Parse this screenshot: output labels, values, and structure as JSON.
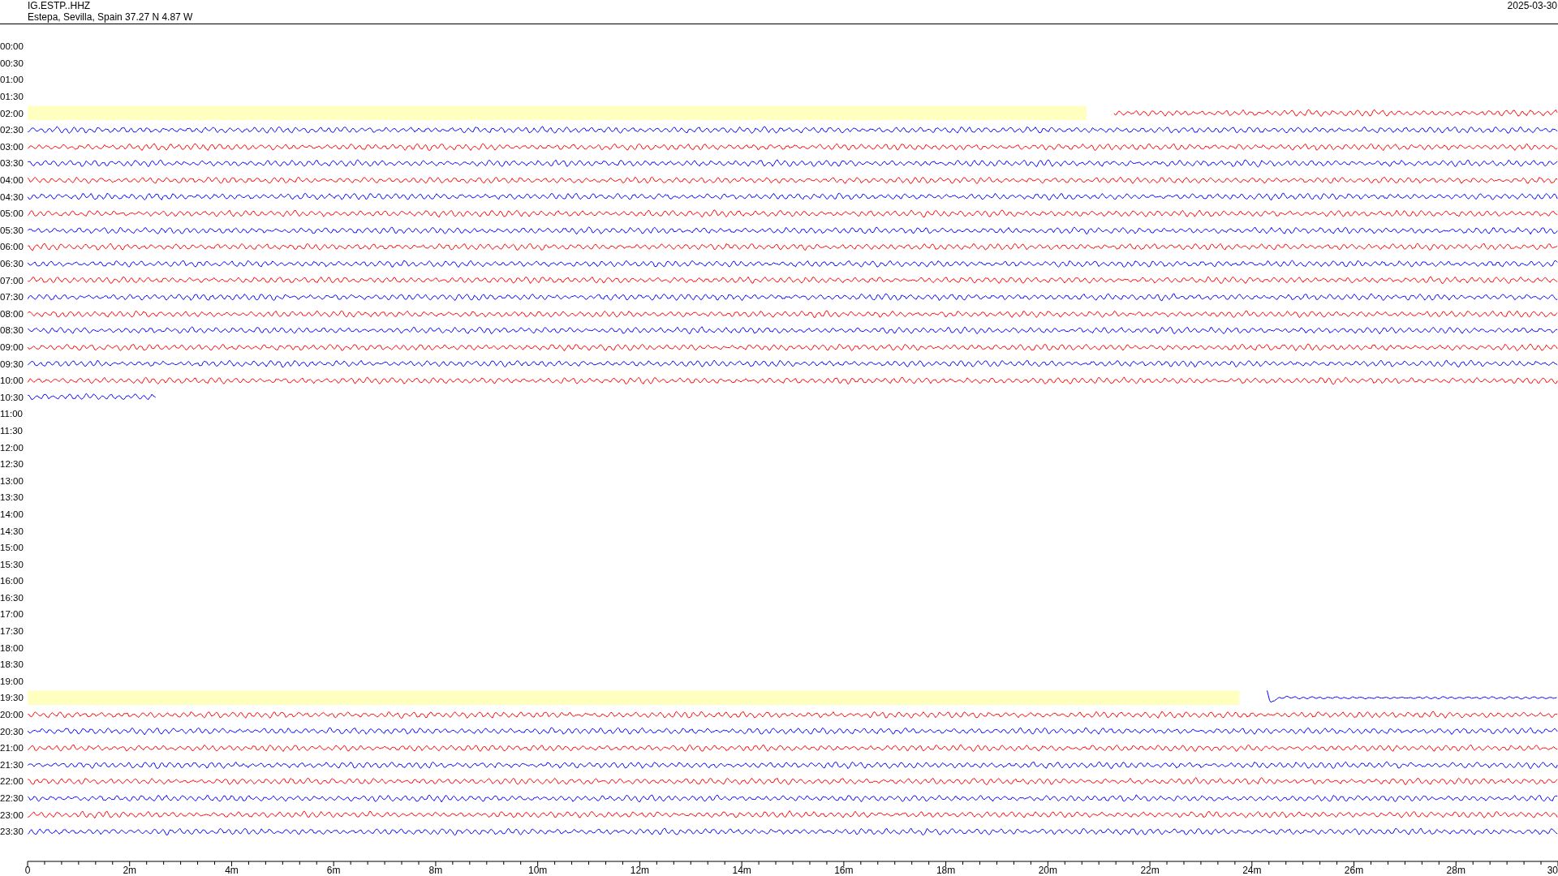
{
  "header": {
    "station": "IG.ESTP..HHZ",
    "location": "Estepa, Sevilla, Spain  37.27 N 4.87 W",
    "date": "2025-03-30"
  },
  "rows": [
    {
      "time": "00:00",
      "kind": "none"
    },
    {
      "time": "00:30",
      "kind": "none"
    },
    {
      "time": "01:00",
      "kind": "none"
    },
    {
      "time": "01:30",
      "kind": "none"
    },
    {
      "time": "02:00",
      "kind": "resumes",
      "color": "#ff0000",
      "level": 0.29
    },
    {
      "time": "02:30",
      "kind": "full",
      "color": "#0000ff"
    },
    {
      "time": "03:00",
      "kind": "full",
      "color": "#ff0000"
    },
    {
      "time": "03:30",
      "kind": "full",
      "color": "#0000ff"
    },
    {
      "time": "04:00",
      "kind": "full",
      "color": "#ff0000"
    },
    {
      "time": "04:30",
      "kind": "full",
      "color": "#0000ff"
    },
    {
      "time": "05:00",
      "kind": "full",
      "color": "#ff0000"
    },
    {
      "time": "05:30",
      "kind": "full",
      "color": "#0000ff"
    },
    {
      "time": "06:00",
      "kind": "full",
      "color": "#ff0000"
    },
    {
      "time": "06:30",
      "kind": "full",
      "color": "#0000ff"
    },
    {
      "time": "07:00",
      "kind": "full",
      "color": "#ff0000"
    },
    {
      "time": "07:30",
      "kind": "full",
      "color": "#0000ff"
    },
    {
      "time": "08:00",
      "kind": "full",
      "color": "#ff0000"
    },
    {
      "time": "08:30",
      "kind": "full",
      "color": "#0000ff"
    },
    {
      "time": "09:00",
      "kind": "full",
      "color": "#ff0000"
    },
    {
      "time": "09:30",
      "kind": "full",
      "color": "#0000ff"
    },
    {
      "time": "10:00",
      "kind": "full",
      "color": "#ff0000"
    },
    {
      "time": "10:30",
      "kind": "ends",
      "color": "#0000ff",
      "level": 0.084
    },
    {
      "time": "11:00",
      "kind": "none"
    },
    {
      "time": "11:30",
      "kind": "none"
    },
    {
      "time": "12:00",
      "kind": "none"
    },
    {
      "time": "12:30",
      "kind": "none"
    },
    {
      "time": "13:00",
      "kind": "none"
    },
    {
      "time": "13:30",
      "kind": "none"
    },
    {
      "time": "14:00",
      "kind": "none"
    },
    {
      "time": "14:30",
      "kind": "none"
    },
    {
      "time": "15:00",
      "kind": "none"
    },
    {
      "time": "15:30",
      "kind": "none"
    },
    {
      "time": "16:00",
      "kind": "none"
    },
    {
      "time": "16:30",
      "kind": "none"
    },
    {
      "time": "17:00",
      "kind": "none"
    },
    {
      "time": "17:30",
      "kind": "none"
    },
    {
      "time": "18:00",
      "kind": "none"
    },
    {
      "time": "18:30",
      "kind": "none"
    },
    {
      "time": "19:00",
      "kind": "none"
    },
    {
      "time": "19:30",
      "kind": "restarts",
      "color": "#0000ff",
      "level": 0.19
    },
    {
      "time": "20:00",
      "kind": "full",
      "color": "#ff0000"
    },
    {
      "time": "20:30",
      "kind": "full",
      "color": "#0000ff"
    },
    {
      "time": "21:00",
      "kind": "full",
      "color": "#ff0000"
    },
    {
      "time": "21:30",
      "kind": "full",
      "color": "#0000ff"
    },
    {
      "time": "22:00",
      "kind": "full",
      "color": "#ff0000"
    },
    {
      "time": "22:30",
      "kind": "full",
      "color": "#0000ff"
    },
    {
      "time": "23:00",
      "kind": "full",
      "color": "#ff0000"
    },
    {
      "time": "23:30",
      "kind": "full",
      "color": "#0000ff"
    }
  ],
  "x_axis": {
    "labels": [
      "0",
      "2m",
      "4m",
      "6m",
      "8m",
      "10m",
      "12m",
      "14m",
      "16m",
      "18m",
      "20m",
      "22m",
      "24m",
      "26m",
      "28m",
      "30"
    ]
  }
}
